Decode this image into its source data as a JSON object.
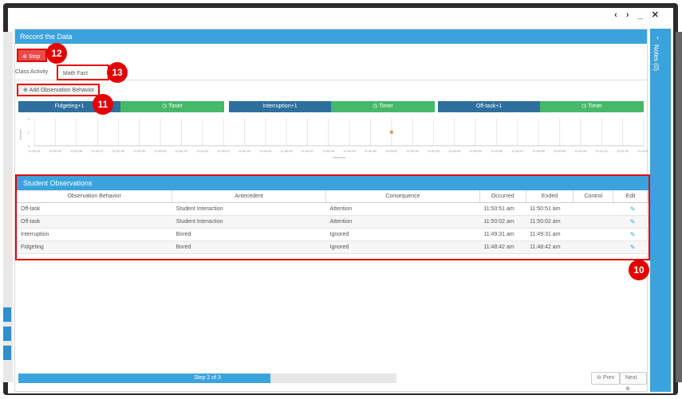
{
  "window_controls": "‹ › _ ✕",
  "panel": {
    "title": "Record the Data"
  },
  "notes": {
    "label": "Notes (0)",
    "chevron": "‹"
  },
  "stop_button": {
    "label": "Stop",
    "icon": "plus-circle-icon"
  },
  "tabs": [
    "Class Activity",
    "Math Fact Review"
  ],
  "add_observation": {
    "label": "Add Observation Behavior",
    "icon": "plus-circle-icon"
  },
  "timer_bars": [
    {
      "label": "Fidgeting+1",
      "color": "#2e6f9e"
    },
    {
      "label": "Timer",
      "color": "#46b86a"
    },
    {
      "label": "Interruption+1",
      "color": "#2e6f9e"
    },
    {
      "label": "Timer",
      "color": "#46b86a"
    },
    {
      "label": "Off-task+1",
      "color": "#2e6f9e"
    },
    {
      "label": "Timer",
      "color": "#46b86a"
    }
  ],
  "chart_data": {
    "type": "scatter",
    "xlabel": "Seconds",
    "ylabel": "Events",
    "ylim": [
      0,
      2
    ],
    "yticks": [
      "2",
      "1",
      "0"
    ],
    "categories": [
      "11:50:34",
      "11:50:35",
      "11:50:36",
      "11:50:37",
      "11:50:38",
      "11:50:39",
      "11:50:40",
      "11:50:41",
      "11:50:42",
      "11:50:43",
      "11:50:44",
      "11:50:45",
      "11:50:46",
      "11:50:47",
      "11:50:48",
      "11:50:49",
      "11:50:50",
      "11:50:51",
      "11:50:52",
      "11:50:53",
      "11:50:54",
      "11:50:55",
      "11:50:56",
      "11:50:57",
      "11:50:58",
      "11:50:59",
      "11:51:00",
      "11:51:01",
      "11:51:02",
      "11:51:03"
    ],
    "points": [
      {
        "x": "11:50:51",
        "y": 1,
        "color": "#f0954a"
      }
    ]
  },
  "observations": {
    "title": "Student Observations",
    "columns": [
      "Observation Behavior",
      "Antecedent",
      "Consequence",
      "Occurred",
      "Ended",
      "Control",
      "Edit"
    ],
    "rows": [
      [
        "Off-task",
        "Student Interaction",
        "Attention",
        "11:50:51 am",
        "11:50:51 am",
        ""
      ],
      [
        "Off-task",
        "Student Interaction",
        "Attention",
        "11:50:02 am",
        "11:50:02 am",
        ""
      ],
      [
        "Interruption",
        "Bored",
        "Ignored",
        "11:49:31 am",
        "11:49:31 am",
        ""
      ],
      [
        "Fidgeting",
        "Bored",
        "Ignored",
        "11:48:42 am",
        "11:48:42 am",
        ""
      ]
    ]
  },
  "progress": {
    "label": "Step 2 of 3",
    "fraction": 0.667
  },
  "nav": {
    "prev": "Prev",
    "next": "Next"
  },
  "callouts": [
    "12",
    "13",
    "11",
    "10"
  ]
}
